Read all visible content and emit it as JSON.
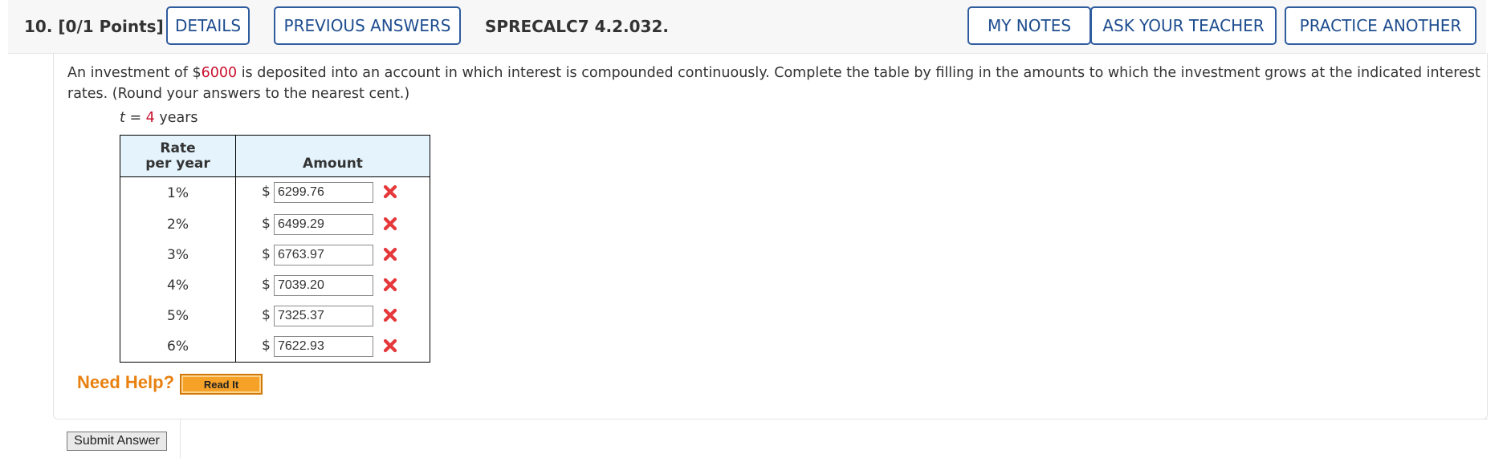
{
  "header": {
    "question_label": "10.  [0/1 Points]",
    "details_label": "DETAILS",
    "previous_answers_label": "PREVIOUS ANSWERS",
    "problem_code": "SPRECALC7 4.2.032.",
    "my_notes_label": "MY NOTES",
    "ask_teacher_label": "ASK YOUR TEACHER",
    "practice_another_label": "PRACTICE ANOTHER",
    "button_color": "#2f5c9e"
  },
  "prompt": {
    "before_amount": "An investment of $",
    "amount": "6000",
    "after_amount": " is deposited into an account in which interest is compounded continuously. Complete the table by filling in the amounts to which the investment grows at the indicated interest rates. (Round your answers to the nearest cent.)",
    "t_var": "t",
    "t_eq": " = ",
    "t_value": "4",
    "t_unit": " years",
    "highlight_color": "#c8102e"
  },
  "table": {
    "header_rate_line1": "Rate",
    "header_rate_line2": "per year",
    "header_amount": "Amount",
    "currency": "$",
    "rows": [
      {
        "rate": "1%",
        "answer": "6299.76",
        "status": "incorrect"
      },
      {
        "rate": "2%",
        "answer": "6499.29",
        "status": "incorrect"
      },
      {
        "rate": "3%",
        "answer": "6763.97",
        "status": "incorrect"
      },
      {
        "rate": "4%",
        "answer": "7039.20",
        "status": "incorrect"
      },
      {
        "rate": "5%",
        "answer": "7325.37",
        "status": "incorrect"
      },
      {
        "rate": "6%",
        "answer": "7622.93",
        "status": "incorrect"
      }
    ],
    "incorrect_icon": "red-x-icon",
    "incorrect_color": "#e5383b"
  },
  "help": {
    "need_help_label": "Need Help?",
    "read_it_label": "Read It"
  },
  "footer": {
    "submit_label": "Submit Answer"
  }
}
